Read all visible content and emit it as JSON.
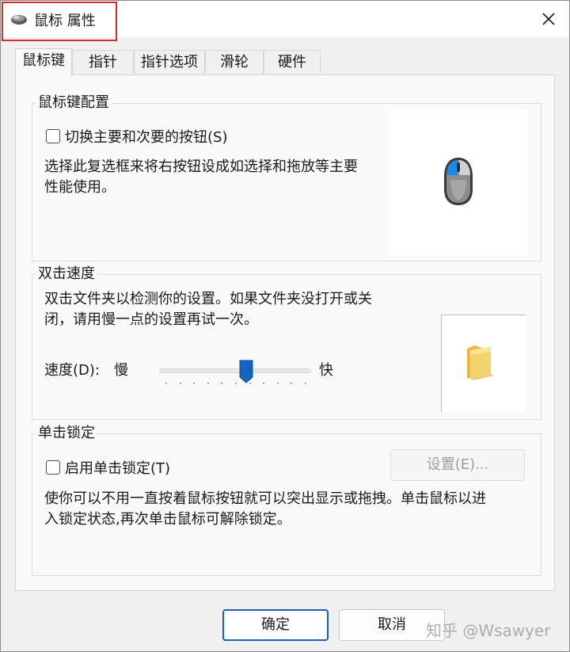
{
  "window": {
    "title": "鼠标 属性",
    "close_glyph": "✕"
  },
  "tabs": [
    {
      "label": "鼠标键",
      "active": true
    },
    {
      "label": "指针",
      "active": false
    },
    {
      "label": "指针选项",
      "active": false
    },
    {
      "label": "滑轮",
      "active": false
    },
    {
      "label": "硬件",
      "active": false
    }
  ],
  "button_config": {
    "title": "鼠标键配置",
    "checkbox_label": "切换主要和次要的按钮(S)",
    "checked": false,
    "description_line1": "选择此复选框来将右按钮设成如选择和拖放等主要",
    "description_line2": "性能使用。"
  },
  "double_click": {
    "title": "双击速度",
    "description_line1": "双击文件夹以检测你的设置。如果文件夹没打开或关",
    "description_line2": "闭，请用慢一点的设置再试一次。",
    "speed_label": "速度(D):",
    "slow_label": "慢",
    "fast_label": "快",
    "slider_value_fraction": 0.58
  },
  "click_lock": {
    "title": "单击锁定",
    "checkbox_label": "启用单击锁定(T)",
    "checked": false,
    "settings_button": "设置(E)...",
    "description_line1": "使你可以不用一直按着鼠标按钮就可以突出显示或拖拽。单击鼠标以进",
    "description_line2": "入锁定状态,再次单击鼠标可解除锁定。"
  },
  "footer": {
    "ok_label": "确定",
    "cancel_label": "取消"
  },
  "watermark": "知乎 @Wsawyer",
  "colors": {
    "highlight_box": "#d62b2b",
    "mouse_accent": "#1e88e5",
    "folder": "#f3d36b"
  }
}
